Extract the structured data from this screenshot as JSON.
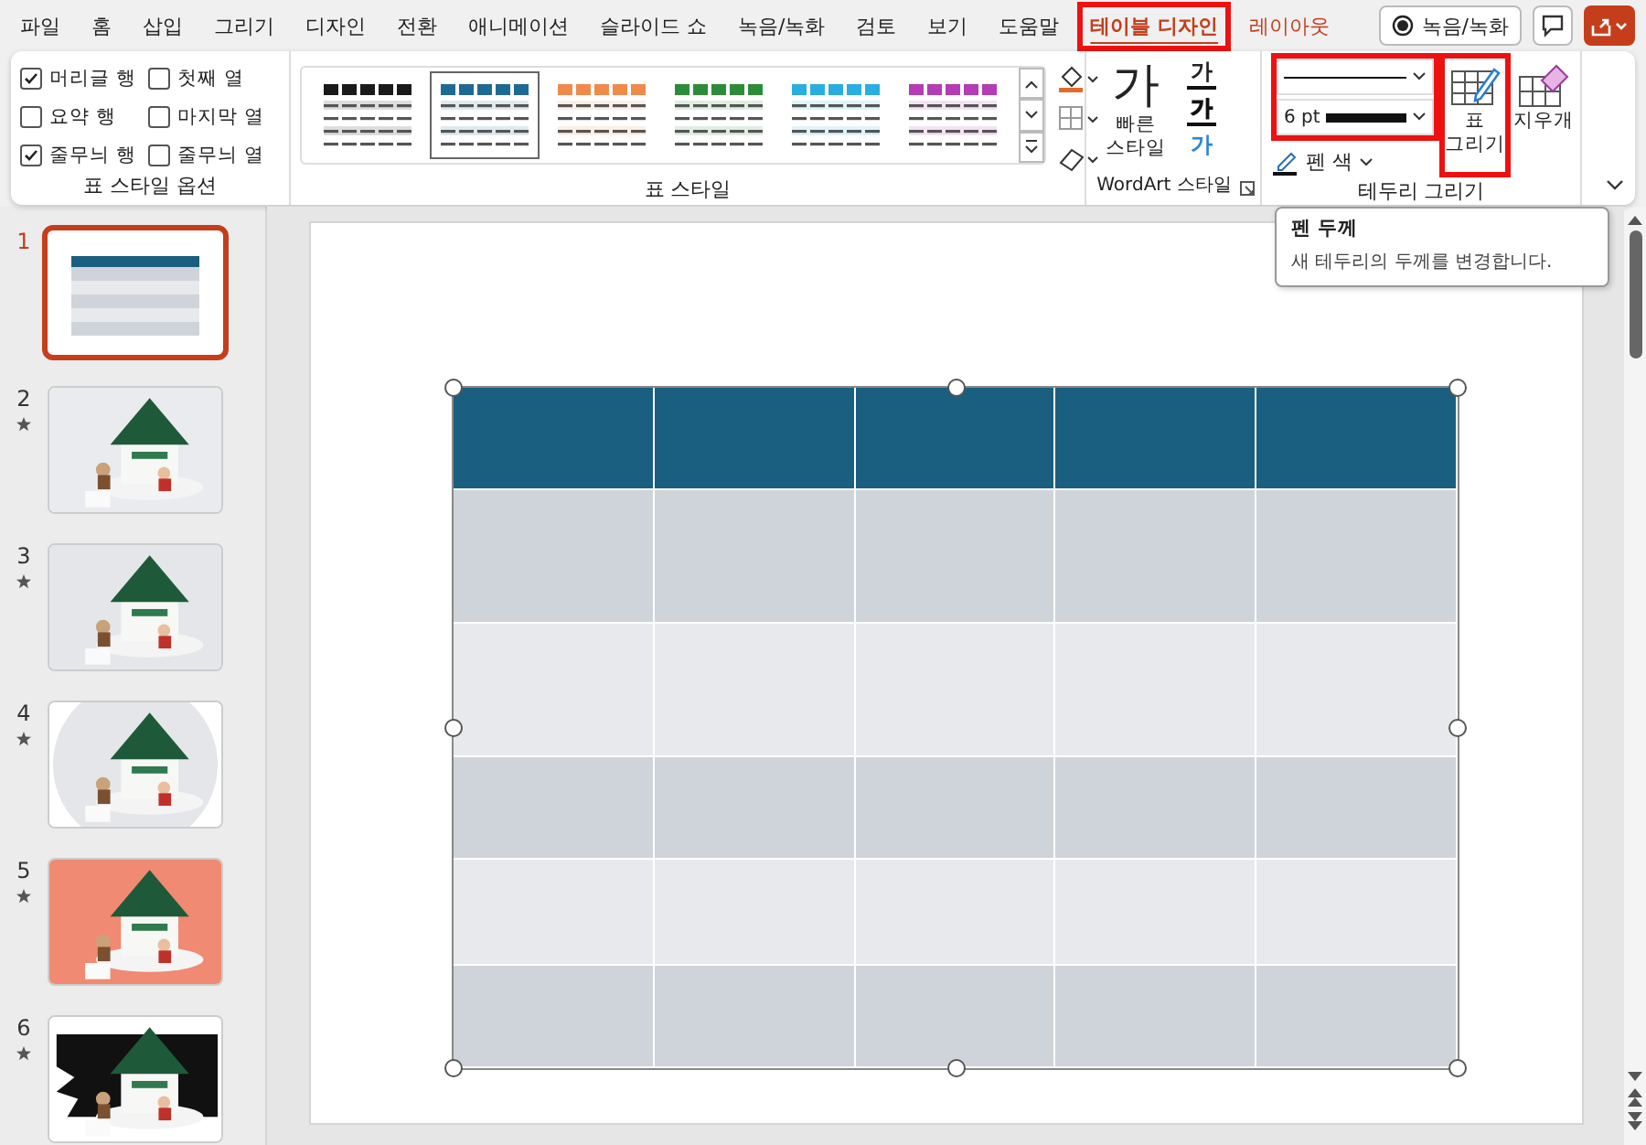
{
  "tabs": [
    {
      "label": "파일",
      "kind": "standard",
      "selected": false,
      "highlighted": false
    },
    {
      "label": "홈",
      "kind": "standard",
      "selected": false,
      "highlighted": false
    },
    {
      "label": "삽입",
      "kind": "standard",
      "selected": false,
      "highlighted": false
    },
    {
      "label": "그리기",
      "kind": "standard",
      "selected": false,
      "highlighted": false
    },
    {
      "label": "디자인",
      "kind": "standard",
      "selected": false,
      "highlighted": false
    },
    {
      "label": "전환",
      "kind": "standard",
      "selected": false,
      "highlighted": false
    },
    {
      "label": "애니메이션",
      "kind": "standard",
      "selected": false,
      "highlighted": false
    },
    {
      "label": "슬라이드 쇼",
      "kind": "standard",
      "selected": false,
      "highlighted": false
    },
    {
      "label": "녹음/녹화",
      "kind": "standard",
      "selected": false,
      "highlighted": false
    },
    {
      "label": "검토",
      "kind": "standard",
      "selected": false,
      "highlighted": false
    },
    {
      "label": "보기",
      "kind": "standard",
      "selected": false,
      "highlighted": false
    },
    {
      "label": "도움말",
      "kind": "standard",
      "selected": false,
      "highlighted": false
    },
    {
      "label": "테이블 디자인",
      "kind": "contextual",
      "selected": true,
      "highlighted": true
    },
    {
      "label": "레이아웃",
      "kind": "contextual",
      "selected": false,
      "highlighted": false
    }
  ],
  "record_button": {
    "label": "녹음/녹화"
  },
  "ribbon": {
    "table_style_options": {
      "label": "표 스타일 옵션",
      "options": [
        {
          "label": "머리글 행",
          "checked": true
        },
        {
          "label": "첫째 열",
          "checked": false
        },
        {
          "label": "요약 행",
          "checked": false
        },
        {
          "label": "마지막 열",
          "checked": false
        },
        {
          "label": "줄무늬 행",
          "checked": true
        },
        {
          "label": "줄무늬 열",
          "checked": false
        }
      ]
    },
    "table_styles": {
      "label": "표 스타일",
      "styles": [
        {
          "color": "#1a1a1a",
          "selected": false
        },
        {
          "color": "#1f6a94",
          "selected": true
        },
        {
          "color": "#f08a4b",
          "selected": false
        },
        {
          "color": "#2e8b3a",
          "selected": false
        },
        {
          "color": "#2aaee0",
          "selected": false
        },
        {
          "color": "#b43cb4",
          "selected": false
        }
      ]
    },
    "wordart": {
      "label": "WordArt 스타일",
      "quick_styles": {
        "glyph": "가",
        "lines": [
          "빠른",
          "스타일"
        ]
      },
      "text_buttons": [
        {
          "glyph": "가",
          "kind": "fill"
        },
        {
          "glyph": "가",
          "kind": "outline"
        },
        {
          "glyph": "가",
          "kind": "effects"
        }
      ]
    },
    "draw_borders": {
      "label": "테두리 그리기",
      "pen": {
        "highlighted": true,
        "weight": "6 pt"
      },
      "pen_color": {
        "label": "펜 색"
      },
      "draw_table": {
        "lines": [
          "표",
          "그리기"
        ],
        "highlighted": true
      },
      "eraser": {
        "label": "지우개"
      }
    }
  },
  "slides": [
    {
      "number": "1",
      "selected": true,
      "animated": false,
      "kind": "table"
    },
    {
      "number": "2",
      "selected": false,
      "animated": true,
      "kind": "picture"
    },
    {
      "number": "3",
      "selected": false,
      "animated": true,
      "kind": "picture"
    },
    {
      "number": "4",
      "selected": false,
      "animated": true,
      "kind": "picture"
    },
    {
      "number": "5",
      "selected": false,
      "animated": true,
      "kind": "picture"
    },
    {
      "number": "6",
      "selected": false,
      "animated": true,
      "kind": "picture"
    }
  ],
  "table": {
    "selected": true,
    "rows": [
      {
        "kind": "header"
      },
      {
        "kind": "band"
      },
      {
        "kind": "plain"
      },
      {
        "kind": "band"
      },
      {
        "kind": "plain"
      },
      {
        "kind": "band"
      }
    ]
  },
  "tooltip": {
    "title": "펜 두께",
    "text": "새 테두리의 두께를 변경합니다."
  }
}
